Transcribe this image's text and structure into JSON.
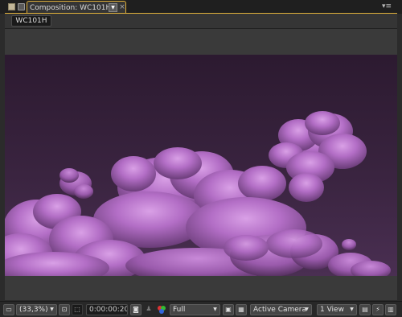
{
  "tab": {
    "title": "Composition: WC101H",
    "dropdown_icon": "chevron-down-icon",
    "close_label": "×",
    "menu_label": "▾≡"
  },
  "breadcrumb": {
    "label": "WC101H"
  },
  "toolbar": {
    "magnification": "(33,3%)",
    "timecode": "0:00:00:20",
    "resolution": "Full",
    "camera": "Active Camera",
    "view_layout": "1 View"
  },
  "colors": {
    "accent": "#e0b03a",
    "panel": "#353535",
    "comp_sky": "#3a2440",
    "cloud": "#b36ec6"
  }
}
